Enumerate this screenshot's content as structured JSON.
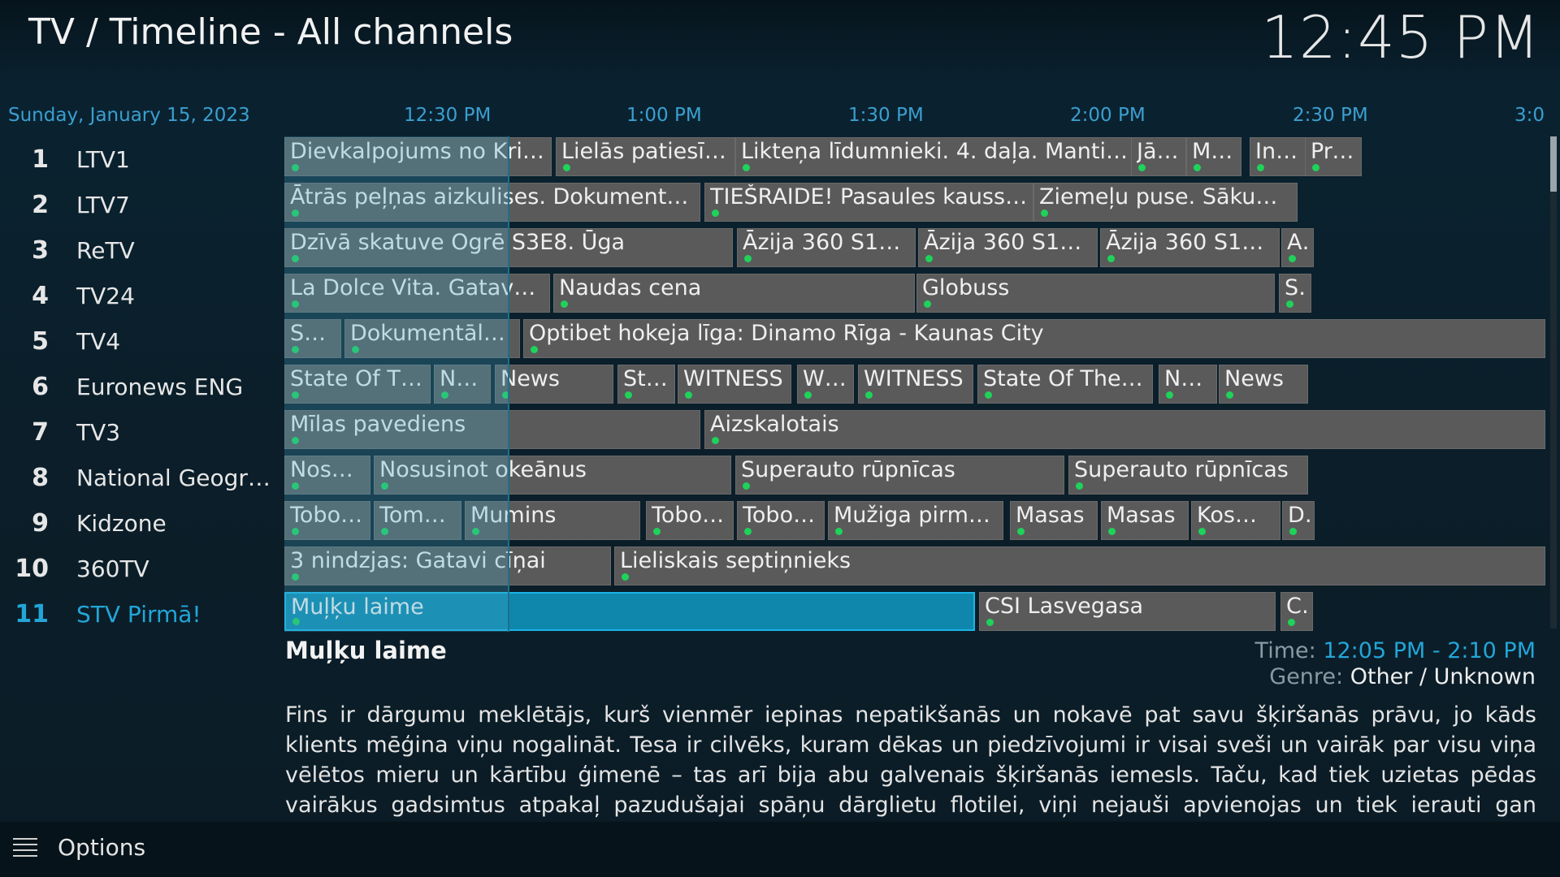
{
  "header": {
    "title": "TV / Timeline - All channels",
    "clock": "12:45 PM"
  },
  "timeline": {
    "date": "Sunday, January 15, 2023",
    "markers": [
      "12:30 PM",
      "1:00 PM",
      "1:30 PM",
      "2:00 PM",
      "2:30 PM",
      "3:0"
    ]
  },
  "channels": [
    {
      "number": "1",
      "name": "LTV1"
    },
    {
      "number": "2",
      "name": "LTV7"
    },
    {
      "number": "3",
      "name": "ReTV"
    },
    {
      "number": "4",
      "name": "TV24"
    },
    {
      "number": "5",
      "name": "TV4"
    },
    {
      "number": "6",
      "name": "Euronews ENG"
    },
    {
      "number": "7",
      "name": "TV3"
    },
    {
      "number": "8",
      "name": "National Geogra..."
    },
    {
      "number": "9",
      "name": "Kidzone"
    },
    {
      "number": "10",
      "name": "360TV"
    },
    {
      "number": "11",
      "name": "STV Pirmā!"
    }
  ],
  "programs": [
    [
      "Dievkalpojums no Kristus Pi...",
      "Lielās patiesības (...",
      "Likteņa līdumnieki. 4. daļa. Mantini...",
      "Jānis...",
      "Mār...",
      "Inta ...",
      "Provin"
    ],
    [
      "Ātrās peļņas aizkulises. Dokumentāla filma",
      "TIEŠRAIDE! Pasaules kauss biatlonā...",
      "Ziemeļu puse. Sākums (atkārto"
    ],
    [
      "Dzīvā skatuve Ogrē S3E8. Ūga",
      "Āzija 360 S1E52. Je...",
      "Āzija 360 S1E53. U...",
      "Āzija 360 S1E54. D...",
      "Aut"
    ],
    [
      "La Dolce Vita. Gatavo gudri!",
      "Naudas cena",
      "Globuss",
      "STU"
    ],
    [
      "Saru...",
      "Dokumentāls stās...",
      "Optibet hokeja līga: Dinamo Rīga - Kaunas City"
    ],
    [
      "State Of The U...",
      "News",
      "News",
      "Stat...",
      "WITNESS",
      "WIT...",
      "WITNESS",
      "State Of The Union",
      "News",
      "News"
    ],
    [
      "Mīlas pavediens",
      "Aizskalotais"
    ],
    [
      "Nosusi...",
      "Nosusinot okeānus",
      "Superauto rūpnīcas",
      "Superauto rūpnīcas"
    ],
    [
      "Toboti: ...",
      "Tomass...",
      "Mumins",
      "Toboti: ...",
      "Toboti: ...",
      "Mužiga pirmdiena",
      "Masas",
      "Masas",
      "Kosmos...",
      "De"
    ],
    [
      "3 nindzjas: Gatavi cīņai",
      "Lieliskais septiņnieks"
    ],
    [
      "Muļķu laime",
      "CSI Lasvegasa",
      "CSI"
    ]
  ],
  "selected": {
    "title": "Muļķu laime",
    "time_label": "Time:",
    "time_value": "12:05 PM - 2:10 PM",
    "genre_label": "Genre:",
    "genre_value": "Other / Unknown",
    "description": "Fins ir dārgumu meklētājs, kurš vienmēr iepinas nepatikšanās un nokavē pat savu šķiršanās prāvu, jo kāds klients mēģina viņu nogalināt. Tesa ir cilvēks, kuram dēkas un piedzīvojumi ir visai sveši un vairāk par visu viņa vēlētos mieru un kārtību ģimenē – tas arī bija abu galvenais šķiršanās iemesls. Taču, kad tiek uzietas pēdas vairākus gadsimtus atpakaļ pazudušajai spāņu dārglietu flotilei, viņi nejauši apvienojas un tiek ierauti gan smieklīgos, gan"
  },
  "footer": {
    "options_label": "Options"
  },
  "colors": {
    "accent": "#22a6d8",
    "cell": "#5a5a5a",
    "selected_cell": "#0f87ad",
    "live_dot": "#1fd25a"
  }
}
